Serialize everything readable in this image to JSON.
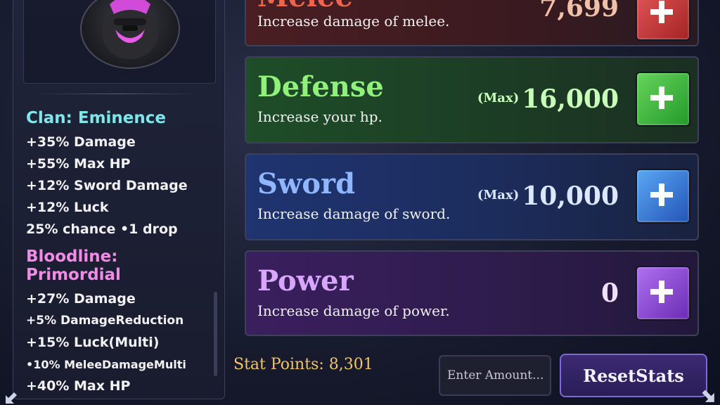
{
  "clan": {
    "heading": "Clan: Eminence",
    "lines": [
      "+35% Damage",
      "+55% Max HP",
      "+12% Sword Damage",
      "+12% Luck",
      "25% chance •1 drop"
    ]
  },
  "bloodline": {
    "heading": "Bloodline: Primordial",
    "lines": [
      "+27% Damage",
      "+5% DamageReduction",
      "+15% Luck(Multi)",
      "•10% MeleeDamageMulti",
      "+40% Max HP"
    ]
  },
  "stats": {
    "melee": {
      "title": "Melee",
      "desc": "Increase damage of melee.",
      "value": "7,699",
      "color": "#f0644e"
    },
    "defense": {
      "title": "Defense",
      "desc": "Increase your hp.",
      "max_tag": "(Max)",
      "value": "16,000",
      "color": "#8ff07a"
    },
    "sword": {
      "title": "Sword",
      "desc": "Increase damage of sword.",
      "max_tag": "(Max)",
      "value": "10,000",
      "color": "#8fb6ff"
    },
    "power": {
      "title": "Power",
      "desc": "Increase damage of power.",
      "value": "0",
      "color": "#d9a6ff"
    }
  },
  "footer": {
    "stat_points": "Stat Points: 8,301",
    "amount_placeholder": "Enter Amount...",
    "reset_label": "ResetStats"
  },
  "icons": {
    "upgrade": "plus-icon",
    "avatar": "character-portrait-icon",
    "resize": "resize-corner-icon"
  }
}
